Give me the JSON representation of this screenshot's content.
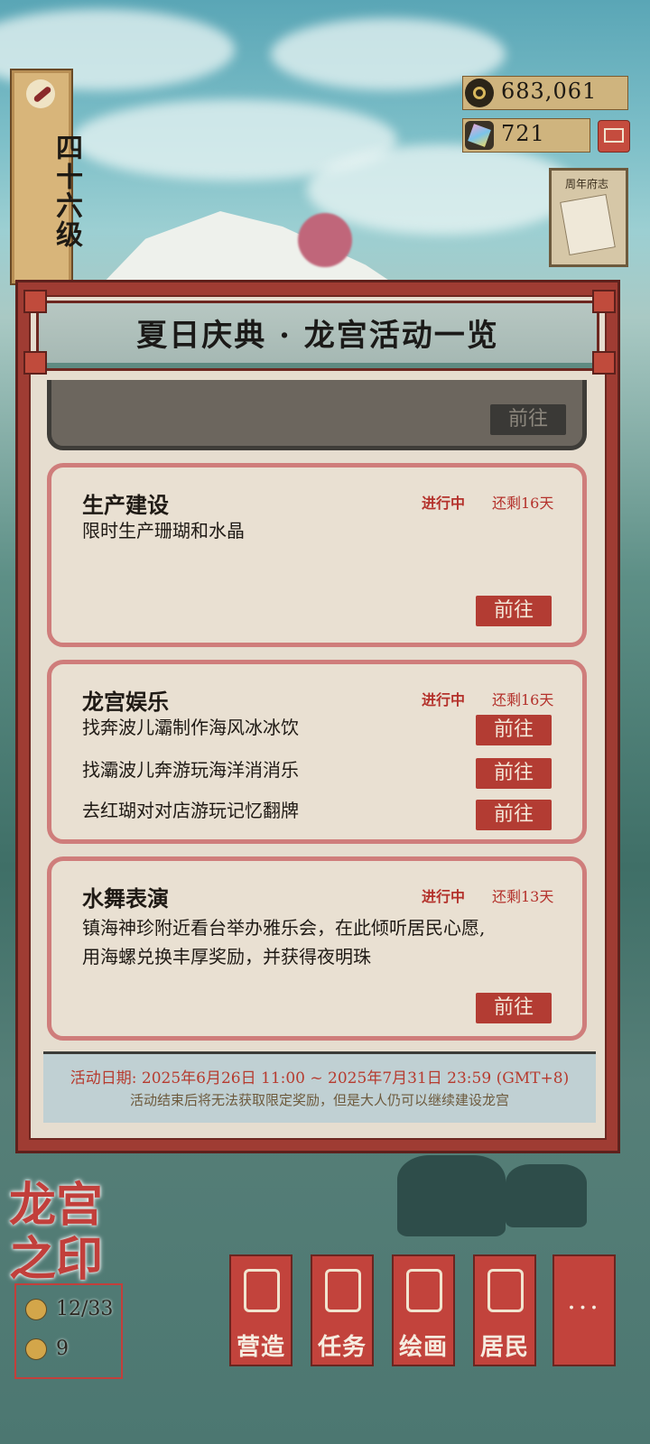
{
  "hud": {
    "level": "四十六级",
    "copper": "683,061",
    "gems": "721",
    "journal_label": "周年府志"
  },
  "panel": {
    "title": "夏日庆典 · 龙宫活动一览",
    "top_button": "前往",
    "cards": [
      {
        "name": "生产建设",
        "status": "进行中",
        "remaining": "还剩16天",
        "desc": "限时生产珊瑚和水晶",
        "button": "前往"
      },
      {
        "name": "龙宫娱乐",
        "status": "进行中",
        "remaining": "还剩16天",
        "items": [
          {
            "text": "找奔波儿灞制作海风冰冰饮",
            "button": "前往"
          },
          {
            "text": "找灞波儿奔游玩海洋消消乐",
            "button": "前往"
          },
          {
            "text": "去红瑚对对店游玩记忆翻牌",
            "button": "前往"
          }
        ]
      },
      {
        "name": "水舞表演",
        "status": "进行中",
        "remaining": "还剩13天",
        "desc_line1": "镇海神珍附近看台举办雅乐会，在此倾听居民心愿,",
        "desc_line2": "用海螺兑换丰厚奖励，并获得夜明珠",
        "button": "前往"
      }
    ],
    "footer_date": "活动日期: 2025年6月26日 11:00 ~ 2025年7月31日 23:59 (GMT+8)",
    "footer_note": "活动结束后将无法获取限定奖励，但是大人仍可以继续建设龙宫"
  },
  "seal": {
    "title_line1": "龙宫",
    "title_line2": "之印",
    "progress": "12/33",
    "coins": "9"
  },
  "nav": {
    "build": "营造",
    "tasks": "任务",
    "paint": "绘画",
    "residents": "居民",
    "more": "···"
  },
  "colors": {
    "accent_red": "#b33c33",
    "status_red": "#b4312b",
    "panel_bg": "#e6ddcf"
  }
}
